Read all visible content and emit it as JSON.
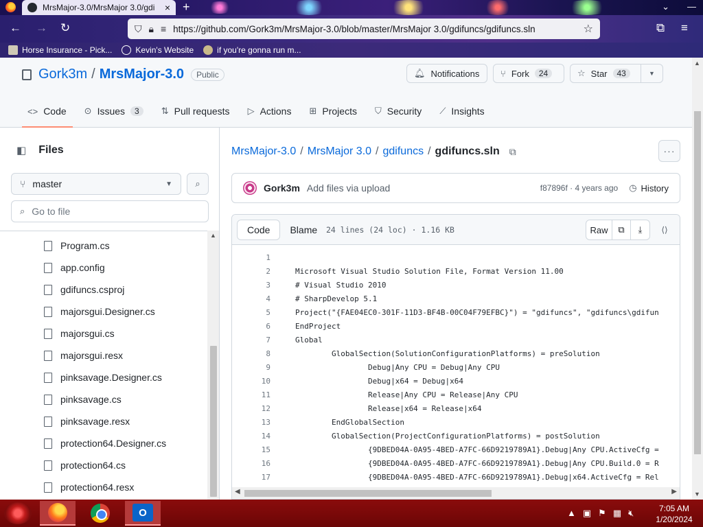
{
  "browser": {
    "tab_title": "MrsMajor-3.0/MrsMajor 3.0/gdi",
    "url": "https://github.com/Gork3m/MrsMajor-3.0/blob/master/MrsMajor 3.0/gdifuncs/gdifuncs.sln",
    "bookmarks": [
      {
        "label": "Horse Insurance - Pick..."
      },
      {
        "label": "Kevin's Website"
      },
      {
        "label": "if you're gonna run m..."
      }
    ]
  },
  "repo": {
    "owner": "Gork3m",
    "name": "MrsMajor-3.0",
    "visibility": "Public",
    "notifications_label": "Notifications",
    "fork_label": "Fork",
    "fork_count": "24",
    "star_label": "Star",
    "star_count": "43",
    "nav": {
      "code": "Code",
      "issues": "Issues",
      "issues_count": "3",
      "pulls": "Pull requests",
      "actions": "Actions",
      "projects": "Projects",
      "security": "Security",
      "insights": "Insights"
    }
  },
  "sidebar": {
    "title": "Files",
    "branch": "master",
    "goto_placeholder": "Go to file",
    "files": [
      "Program.cs",
      "app.config",
      "gdifuncs.csproj",
      "majorsgui.Designer.cs",
      "majorsgui.cs",
      "majorsgui.resx",
      "pinksavage.Designer.cs",
      "pinksavage.cs",
      "pinksavage.resx",
      "protection64.Designer.cs",
      "protection64.cs",
      "protection64.resx"
    ]
  },
  "breadcrumb": {
    "root": "MrsMajor-3.0",
    "dir1": "MrsMajor 3.0",
    "dir2": "gdifuncs",
    "file": "gdifuncs.sln"
  },
  "commit": {
    "author": "Gork3m",
    "message": "Add files via upload",
    "sha_time": "f87896f · 4 years ago",
    "history_label": "History"
  },
  "code": {
    "tab_code": "Code",
    "tab_blame": "Blame",
    "meta": "24 lines (24 loc) · 1.16 KB",
    "raw_label": "Raw",
    "lines": [
      {
        "no": "1",
        "text": ""
      },
      {
        "no": "2",
        "text": "Microsoft Visual Studio Solution File, Format Version 11.00"
      },
      {
        "no": "3",
        "text": "# Visual Studio 2010"
      },
      {
        "no": "4",
        "text": "# SharpDevelop 5.1"
      },
      {
        "no": "5",
        "text": "Project(\"{FAE04EC0-301F-11D3-BF4B-00C04F79EFBC}\") = \"gdifuncs\", \"gdifuncs\\gdifun"
      },
      {
        "no": "6",
        "text": "EndProject"
      },
      {
        "no": "7",
        "text": "Global"
      },
      {
        "no": "8",
        "text": "        GlobalSection(SolutionConfigurationPlatforms) = preSolution"
      },
      {
        "no": "9",
        "text": "                Debug|Any CPU = Debug|Any CPU"
      },
      {
        "no": "10",
        "text": "                Debug|x64 = Debug|x64"
      },
      {
        "no": "11",
        "text": "                Release|Any CPU = Release|Any CPU"
      },
      {
        "no": "12",
        "text": "                Release|x64 = Release|x64"
      },
      {
        "no": "13",
        "text": "        EndGlobalSection"
      },
      {
        "no": "14",
        "text": "        GlobalSection(ProjectConfigurationPlatforms) = postSolution"
      },
      {
        "no": "15",
        "text": "                {9DBED04A-0A95-4BED-A7FC-66D9219789A1}.Debug|Any CPU.ActiveCfg = "
      },
      {
        "no": "16",
        "text": "                {9DBED04A-0A95-4BED-A7FC-66D9219789A1}.Debug|Any CPU.Build.0 = R"
      },
      {
        "no": "17",
        "text": "                {9DBED04A-0A95-4BED-A7FC-66D9219789A1}.Debug|x64.ActiveCfg = Rel"
      }
    ]
  },
  "taskbar": {
    "time": "7:05 AM",
    "date": "1/20/2024"
  },
  "colors": {
    "link": "#0969da",
    "underline": "#fd8c73",
    "taskbar": "#8a0c0c"
  }
}
